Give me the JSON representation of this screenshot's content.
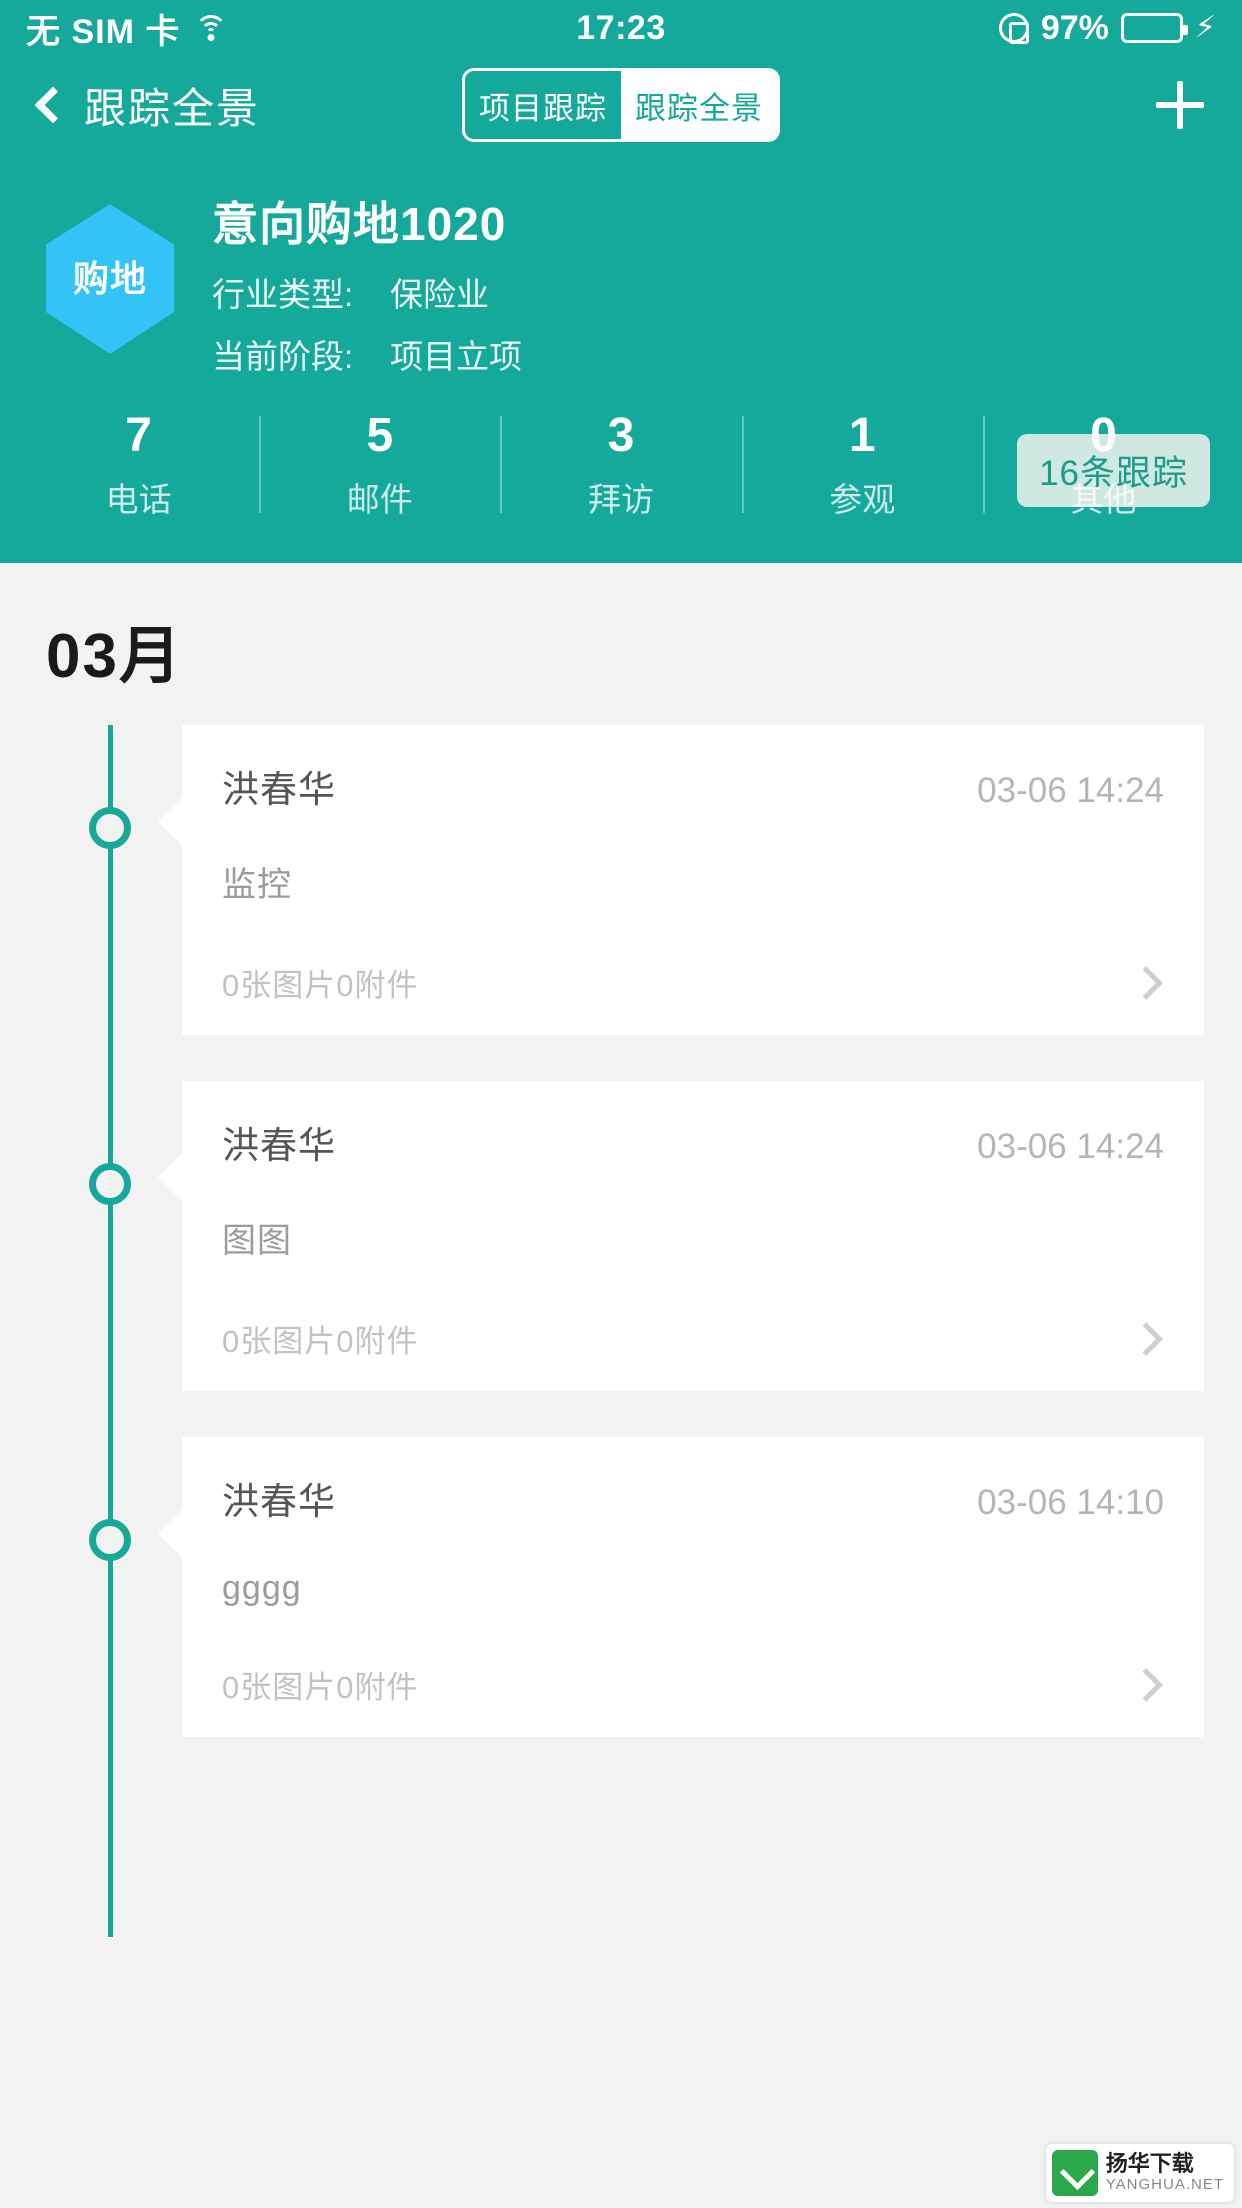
{
  "statusbar": {
    "carrier": "无 SIM 卡",
    "wifi_icon": "wifi-icon",
    "time": "17:23",
    "rotation_lock_icon": "rotation-lock-icon",
    "battery_percent": "97%",
    "battery_icon": "battery-icon",
    "charging_icon": "⚡"
  },
  "navbar": {
    "back_icon": "chevron-left-icon",
    "back_title": "跟踪全景",
    "segments": [
      {
        "label": "项目跟踪",
        "selected": false
      },
      {
        "label": "跟踪全景",
        "selected": true
      }
    ],
    "add_icon": "plus-icon"
  },
  "header": {
    "badge_label": "购地",
    "project_name": "意向购地1020",
    "rows": [
      {
        "key": "行业类型:",
        "value": "保险业"
      },
      {
        "key": "当前阶段:",
        "value": "项目立项"
      }
    ],
    "track_count_badge": "16条跟踪",
    "stats": [
      {
        "num": "7",
        "label": "电话"
      },
      {
        "num": "5",
        "label": "邮件"
      },
      {
        "num": "3",
        "label": "拜访"
      },
      {
        "num": "1",
        "label": "参观"
      },
      {
        "num": "0",
        "label": "其他"
      }
    ]
  },
  "timeline": {
    "month_label": "03月",
    "items": [
      {
        "name": "洪春华",
        "time": "03-06 14:24",
        "body": "监控",
        "images": "0张图片",
        "attachments": "0附件",
        "chevron_icon": "chevron-right-icon"
      },
      {
        "name": "洪春华",
        "time": "03-06 14:24",
        "body": "图图",
        "images": "0张图片",
        "attachments": "0附件",
        "chevron_icon": "chevron-right-icon"
      },
      {
        "name": "洪春华",
        "time": "03-06 14:10",
        "body": "gggg",
        "images": "0张图片",
        "attachments": "0附件",
        "chevron_icon": "chevron-right-icon"
      }
    ]
  },
  "watermark": {
    "title": "扬华下载",
    "subtitle": "YANGHUA.NET"
  },
  "colors": {
    "brand_teal": "#14a99a",
    "badge_blue": "#32c3f7",
    "page_bg": "#f2f2f2",
    "track_badge_bg": "#cfe8e1",
    "track_badge_text": "#1b9c8c"
  }
}
